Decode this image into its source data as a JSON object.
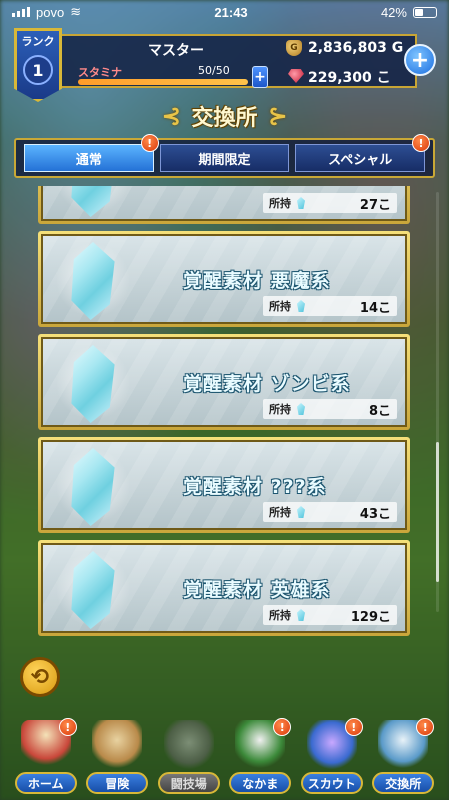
{
  "status_bar": {
    "carrier": "povo",
    "time": "21:43",
    "battery": "42%"
  },
  "header": {
    "rank_label": "ランク",
    "rank_value": "1",
    "player_name": "マスター",
    "gold_icon": "money-bag-icon",
    "gold": "2,836,803 G",
    "stamina_label": "スタミナ",
    "stamina_value": "50/50",
    "stamina_fraction": 1.0,
    "stamina_plus": "+",
    "gem_icon": "red-gem-icon",
    "gems": "229,300 こ",
    "big_plus": "+"
  },
  "title": {
    "text": "交換所",
    "left_ornament": "⊰",
    "right_ornament": "⊱"
  },
  "tabs": [
    {
      "label": "通常",
      "active": true,
      "badge": "!"
    },
    {
      "label": "期間限定",
      "active": false,
      "badge": ""
    },
    {
      "label": "スペシャル",
      "active": false,
      "badge": "!"
    }
  ],
  "owned_label": "所持",
  "items": [
    {
      "name": "",
      "count": "27こ"
    },
    {
      "name": "覚醒素材 悪魔系",
      "count": "14こ"
    },
    {
      "name": "覚醒素材 ゾンビ系",
      "count": "8こ"
    },
    {
      "name": "覚醒素材 ???系",
      "count": "43こ"
    },
    {
      "name": "覚醒素材 英雄系",
      "count": "129こ"
    }
  ],
  "back_button": "⟲",
  "nav": [
    {
      "label": "ホーム",
      "badge": "!",
      "locked": false,
      "art_color": "#c9473a"
    },
    {
      "label": "冒険",
      "badge": "",
      "locked": false,
      "art_color": "#b98a4a"
    },
    {
      "label": "闘技場",
      "badge": "",
      "locked": true,
      "art_color": "#777777"
    },
    {
      "label": "なかま",
      "badge": "!",
      "locked": false,
      "art_color": "#3c8a3a"
    },
    {
      "label": "スカウト",
      "badge": "!",
      "locked": false,
      "art_color": "#3a6ad0"
    },
    {
      "label": "交換所",
      "badge": "!",
      "locked": false,
      "art_color": "#5a9ac9"
    }
  ]
}
